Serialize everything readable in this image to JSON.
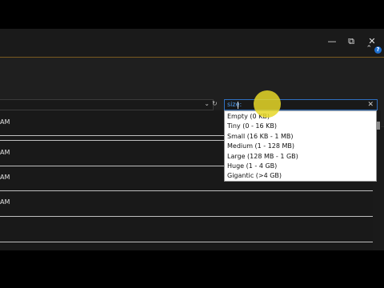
{
  "window_controls": {
    "minimize": "—",
    "maximize": "⧉",
    "close": "✕"
  },
  "help": {
    "label": "?"
  },
  "search": {
    "text": "size:",
    "clear": "✕"
  },
  "list": {
    "rows": [
      {
        "text": "AM"
      },
      {
        "text": ""
      },
      {
        "text": "AM"
      },
      {
        "text": "AM"
      },
      {
        "text": "AM"
      }
    ]
  },
  "size_filter_dropdown": {
    "options": [
      "Empty (0 KB)",
      "Tiny (0 - 16 KB)",
      "Small (16 KB - 1 MB)",
      "Medium (1 - 128 MB)",
      "Large (128 MB - 1 GB)",
      "Huge (1 - 4 GB)",
      "Gigantic (>4 GB)"
    ]
  }
}
